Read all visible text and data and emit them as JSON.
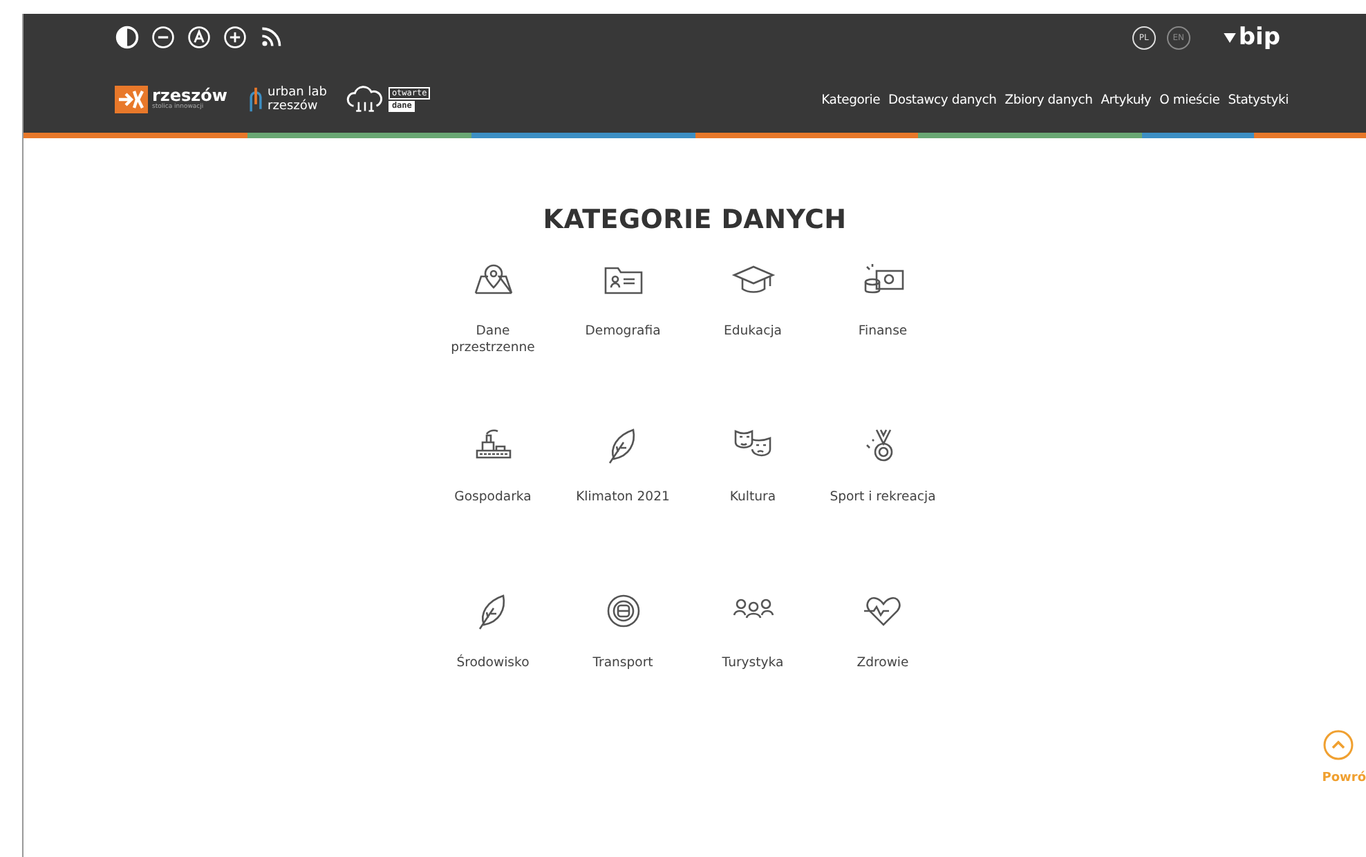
{
  "languages": [
    {
      "label": "PL",
      "selected": true
    },
    {
      "label": "EN",
      "selected": false
    }
  ],
  "bip": {
    "label": "bip"
  },
  "logos": {
    "city": {
      "name": "rzeszów",
      "tagline": "stolica innowacji"
    },
    "urban_lab": {
      "line_1": "urban lab",
      "line_2": "rzeszów"
    },
    "open_data": {
      "line_1": "otwarte",
      "line_2": "dane"
    }
  },
  "nav": [
    "Kategorie",
    "Dostawcy danych",
    "Zbiory danych",
    "Artykuły",
    "O mieście",
    "Statystyki"
  ],
  "title": "KATEGORIE DANYCH",
  "categories": [
    {
      "label": "Dane przestrzenne"
    },
    {
      "label": "Demografia"
    },
    {
      "label": "Edukacja"
    },
    {
      "label": "Finanse"
    },
    {
      "label": "Gospodarka"
    },
    {
      "label": "Klimaton 2021"
    },
    {
      "label": "Kultura"
    },
    {
      "label": "Sport i rekreacja"
    },
    {
      "label": "Środowisko"
    },
    {
      "label": "Transport"
    },
    {
      "label": "Turystyka"
    },
    {
      "label": "Zdrowie"
    }
  ],
  "back_to_top": {
    "label": "Powró"
  }
}
